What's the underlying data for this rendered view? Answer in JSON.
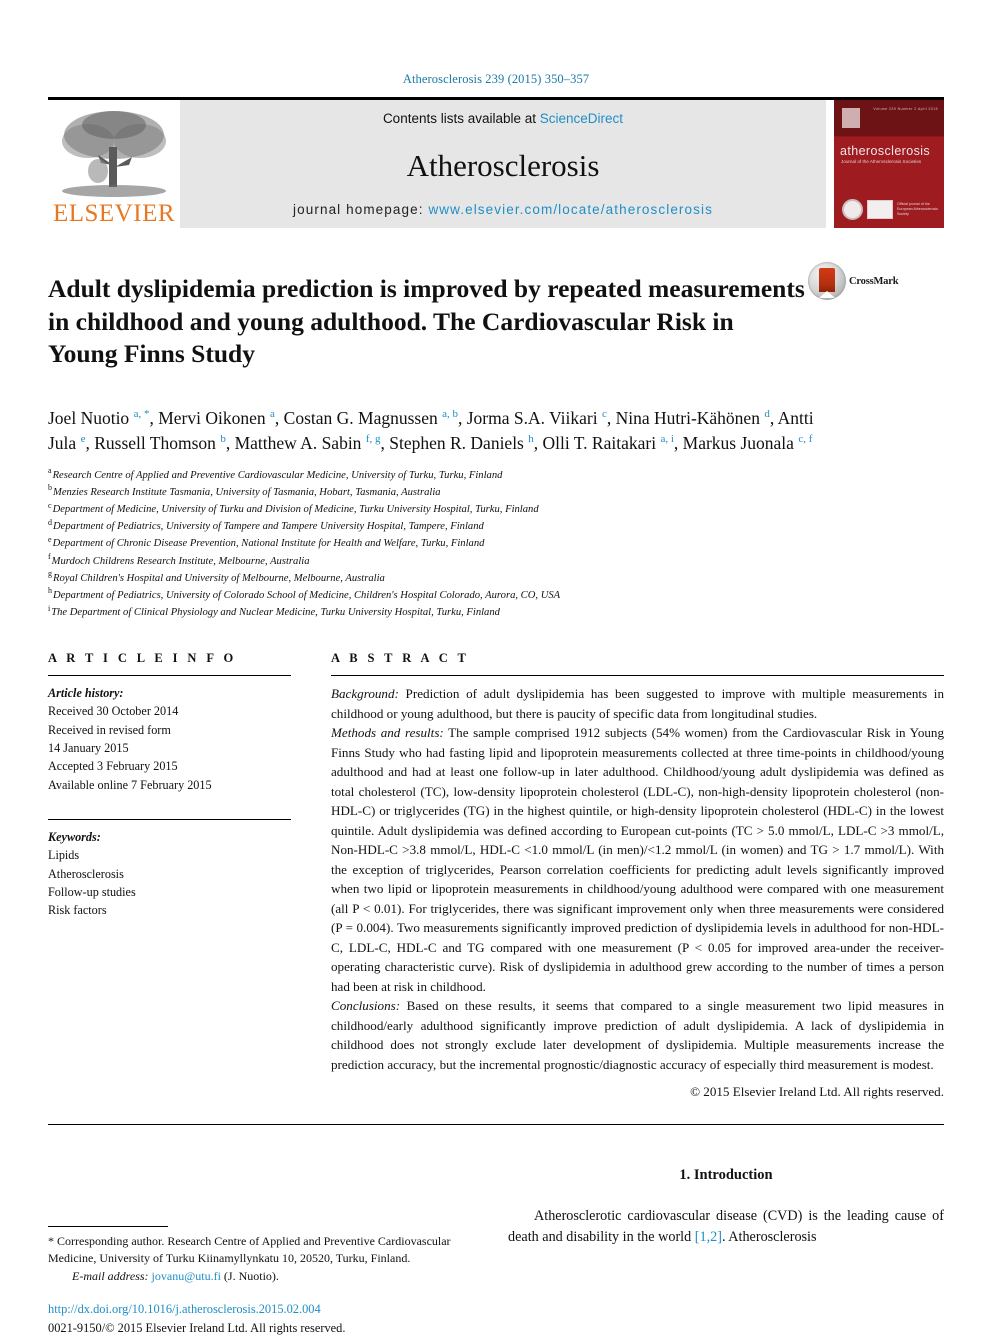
{
  "running_head": "Atherosclerosis 239 (2015) 350–357",
  "masthead": {
    "publisher_name": "ELSEVIER",
    "contents_prefix": "Contents lists available at ",
    "contents_link": "ScienceDirect",
    "journal_name": "Atherosclerosis",
    "homepage_prefix": "journal homepage: ",
    "homepage_url": "www.elsevier.com/locate/atherosclerosis",
    "cover": {
      "title": "atherosclerosis",
      "subtitle": "Journal of the Atherosclerosis Societies",
      "topline": "Volume 239  Number 2  April 2015",
      "badge_text": "Official journal of the European Atherosclerosis Society"
    }
  },
  "article": {
    "title": "Adult dyslipidemia prediction is improved by repeated measurements in childhood and young adulthood. The Cardiovascular Risk in Young Finns Study",
    "crossmark_label": "CrossMark",
    "authors_html": "Joel Nuotio <sup>a, *</sup>, Mervi Oikonen <sup>a</sup>, Costan G. Magnussen <sup>a, b</sup>, Jorma S.A. Viikari <sup>c</sup>, Nina Hutri-Kähönen <sup>d</sup>, Antti Jula <sup>e</sup>, Russell Thomson <sup>b</sup>, Matthew A. Sabin <sup>f, g</sup>, Stephen R. Daniels <sup>h</sup>, Olli T. Raitakari <sup>a, i</sup>, Markus Juonala <sup>c, f</sup>",
    "affiliations": [
      {
        "marker": "a",
        "text": "Research Centre of Applied and Preventive Cardiovascular Medicine, University of Turku, Turku, Finland"
      },
      {
        "marker": "b",
        "text": "Menzies Research Institute Tasmania, University of Tasmania, Hobart, Tasmania, Australia"
      },
      {
        "marker": "c",
        "text": "Department of Medicine, University of Turku and Division of Medicine, Turku University Hospital, Turku, Finland"
      },
      {
        "marker": "d",
        "text": "Department of Pediatrics, University of Tampere and Tampere University Hospital, Tampere, Finland"
      },
      {
        "marker": "e",
        "text": "Department of Chronic Disease Prevention, National Institute for Health and Welfare, Turku, Finland"
      },
      {
        "marker": "f",
        "text": "Murdoch Childrens Research Institute, Melbourne, Australia"
      },
      {
        "marker": "g",
        "text": "Royal Children's Hospital and University of Melbourne, Melbourne, Australia"
      },
      {
        "marker": "h",
        "text": "Department of Pediatrics, University of Colorado School of Medicine, Children's Hospital Colorado, Aurora, CO, USA"
      },
      {
        "marker": "i",
        "text": "The Department of Clinical Physiology and Nuclear Medicine, Turku University Hospital, Turku, Finland"
      }
    ]
  },
  "article_info": {
    "heading": "A R T I C L E   I N F O",
    "history_label": "Article history:",
    "history_lines": [
      "Received 30 October 2014",
      "Received in revised form",
      "14 January 2015",
      "Accepted 3 February 2015",
      "Available online 7 February 2015"
    ],
    "keywords_label": "Keywords:",
    "keywords": [
      "Lipids",
      "Atherosclerosis",
      "Follow-up studies",
      "Risk factors"
    ]
  },
  "abstract": {
    "heading": "A B S T R A C T",
    "background_label": "Background:",
    "background_text": " Prediction of adult dyslipidemia has been suggested to improve with multiple measurements in childhood or young adulthood, but there is paucity of specific data from longitudinal studies.",
    "methods_label": "Methods and results:",
    "methods_text": " The sample comprised 1912 subjects (54% women) from the Cardiovascular Risk in Young Finns Study who had fasting lipid and lipoprotein measurements collected at three time-points in childhood/young adulthood and had at least one follow-up in later adulthood. Childhood/young adult dyslipidemia was defined as total cholesterol (TC), low-density lipoprotein cholesterol (LDL-C), non-high-density lipoprotein cholesterol (non-HDL-C) or triglycerides (TG) in the highest quintile, or high-density lipoprotein cholesterol (HDL-C) in the lowest quintile. Adult dyslipidemia was defined according to European cut-points (TC > 5.0 mmol/L, LDL-C >3 mmol/L, Non-HDL-C >3.8 mmol/L, HDL-C <1.0 mmol/L (in men)/<1.2 mmol/L (in women) and TG > 1.7 mmol/L). With the exception of triglycerides, Pearson correlation coefficients for predicting adult levels significantly improved when two lipid or lipoprotein measurements in childhood/young adulthood were compared with one measurement (all P < 0.01). For triglycerides, there was significant improvement only when three measurements were considered (P = 0.004). Two measurements significantly improved prediction of dyslipidemia levels in adulthood for non-HDL-C, LDL-C, HDL-C and TG compared with one measurement (P < 0.05 for improved area-under the receiver-operating characteristic curve). Risk of dyslipidemia in adulthood grew according to the number of times a person had been at risk in childhood.",
    "conclusions_label": "Conclusions:",
    "conclusions_text": " Based on these results, it seems that compared to a single measurement two lipid measures in childhood/early adulthood significantly improve prediction of adult dyslipidemia. A lack of dyslipidemia in childhood does not strongly exclude later development of dyslipidemia. Multiple measurements increase the prediction accuracy, but the incremental prognostic/diagnostic accuracy of especially third measurement is modest.",
    "copyright": "© 2015 Elsevier Ireland Ltd. All rights reserved."
  },
  "footer": {
    "corresponding_marker": "*",
    "corresponding_text": " Corresponding author. Research Centre of Applied and Preventive Cardiovascular Medicine, University of Turku Kiinamyllynkatu 10, 20520, Turku, Finland.",
    "email_label": "E-mail address:",
    "email_link": "jovanu@utu.fi",
    "email_suffix": " (J. Nuotio).",
    "doi_url": "http://dx.doi.org/10.1016/j.atherosclerosis.2015.02.004",
    "issn_line": "0021-9150/© 2015 Elsevier Ireland Ltd. All rights reserved."
  },
  "introduction": {
    "heading": "1. Introduction",
    "paragraph_pre": "Atherosclerotic cardiovascular disease (CVD) is the leading cause of death and disability in the world ",
    "citation": "[1,2]",
    "paragraph_post": ". Atherosclerosis"
  },
  "colors": {
    "link": "#1f8fc4",
    "elsevier_orange": "#e87722",
    "cover_red": "#9e1b20",
    "masthead_grey": "#e6e6e6"
  }
}
